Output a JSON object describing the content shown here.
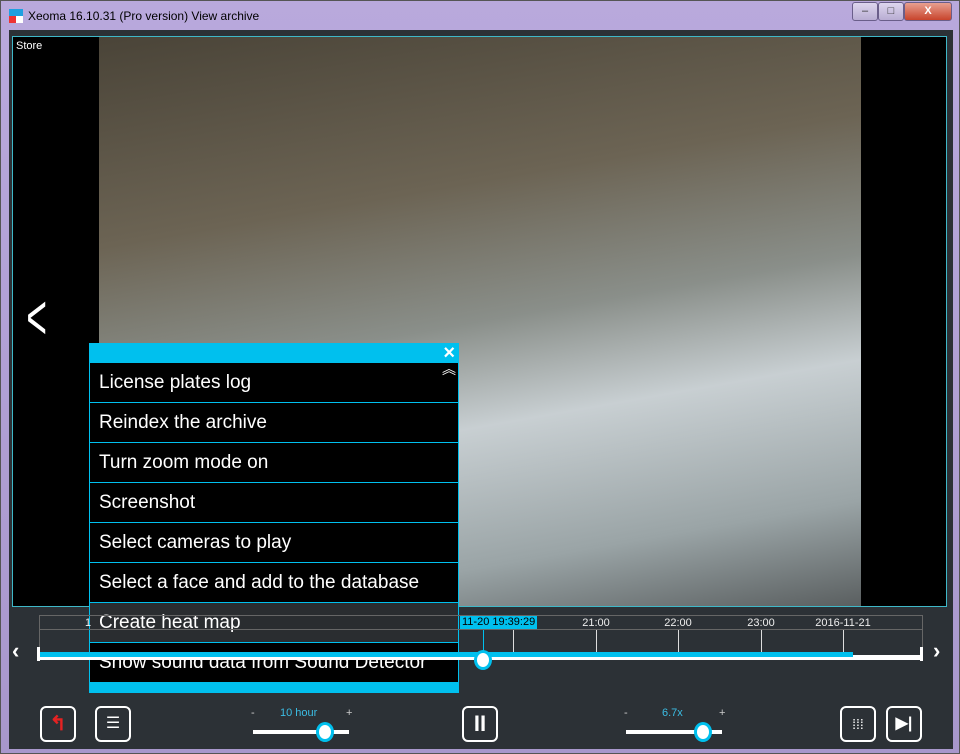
{
  "window": {
    "title": "Xeoma 16.10.31 (Pro version) View archive",
    "minimize": "–",
    "maximize": "□",
    "close": "X"
  },
  "camera": {
    "name": "Store"
  },
  "menu": {
    "close_icon": "×",
    "collapse_icon": "︽",
    "items": [
      {
        "label": "License plates log"
      },
      {
        "label": "Reindex the archive"
      },
      {
        "label": "Turn zoom mode on"
      },
      {
        "label": "Screenshot"
      },
      {
        "label": "Select cameras to play"
      },
      {
        "label": "Select a face and add to the database"
      },
      {
        "label": "Create heat map",
        "highlighted": true
      },
      {
        "label": "Show sound data from Sound Detector"
      }
    ]
  },
  "timeline": {
    "partial_left_label": "1",
    "current": "11-20 19:39:29",
    "labels": [
      "21:00",
      "22:00",
      "23:00",
      "2016-11-21"
    ],
    "accent": "#00c0ee"
  },
  "controls": {
    "scale_minus": "-",
    "scale_value": "10 hour",
    "scale_plus": "+",
    "speed_minus": "-",
    "speed_value": "6.7x",
    "speed_plus": "+",
    "pause_icon": "II",
    "next_icon": "▶|"
  }
}
